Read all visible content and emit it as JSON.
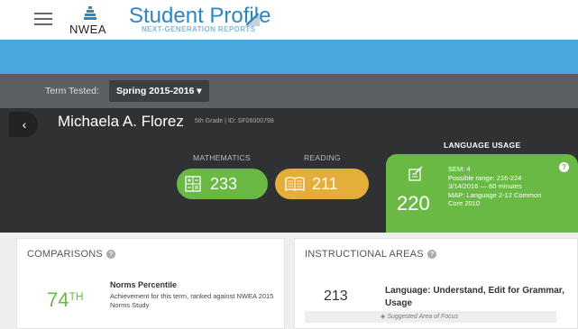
{
  "header": {
    "logo_text": "NWEA",
    "title": "Student Profile",
    "subtitle": "NEXT-GENERATION REPORTS"
  },
  "term": {
    "label": "Term Tested:",
    "selected": "Spring 2015-2016 ▾"
  },
  "student": {
    "name": "Michaela A. Florez",
    "meta": "5th Grade  |  ID: SF06000798"
  },
  "scores": {
    "mathematics": {
      "label": "MATHEMATICS",
      "value": "233"
    },
    "reading": {
      "label": "READING",
      "value": "211"
    },
    "language_usage": {
      "label": "LANGUAGE USAGE",
      "value": "220",
      "sem": "SEM: 4",
      "range": "Possible range: 216-224",
      "date": "3/14/2016 — 60 minutes",
      "map": "MAP: Language 2-12 Common",
      "map2": "Core 2010"
    }
  },
  "comparisons": {
    "title": "COMPARISONS",
    "percentile": "74",
    "percentile_suffix": "TH",
    "norms_title": "Norms Percentile",
    "norms_desc": "Achievement for this term, ranked against NWEA 2015 Norms Study"
  },
  "instructional": {
    "title": "INSTRUCTIONAL AREAS",
    "score": "213",
    "area": "Language: Understand, Edit for Grammar, Usage",
    "suggested": "Suggested Area of Focus"
  },
  "colors": {
    "green": "#6ab945",
    "orange": "#e5ad3a",
    "blue": "#4aa7de",
    "dark": "#2f3133"
  }
}
